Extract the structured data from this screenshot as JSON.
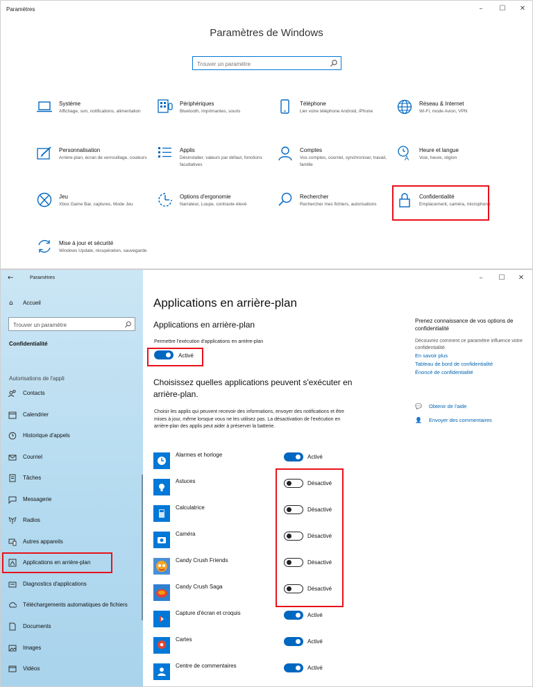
{
  "top_window": {
    "title": "Paramètres",
    "heading": "Paramètres de Windows",
    "search_placeholder": "Trouver un paramètre",
    "categories": [
      {
        "icon": "laptop-icon",
        "title": "Système",
        "desc": "Affichage, son, notifications, alimentation"
      },
      {
        "icon": "keyboard-icon",
        "title": "Périphériques",
        "desc": "Bluetooth, imprimantes, souris"
      },
      {
        "icon": "phone-icon",
        "title": "Téléphone",
        "desc": "Lier votre téléphone Android, iPhone"
      },
      {
        "icon": "globe-icon",
        "title": "Réseau & Internet",
        "desc": "Wi-Fi, mode Avion, VPN"
      },
      {
        "icon": "paint-brush-icon",
        "title": "Personnalisation",
        "desc": "Arrière-plan, écran de verrouillage, couleurs"
      },
      {
        "icon": "apps-list-icon",
        "title": "Applis",
        "desc": "Désinstaller, valeurs par défaut, fonctions facultatives"
      },
      {
        "icon": "person-icon",
        "title": "Comptes",
        "desc": "Vos comptes, courriel, synchroniser, travail, famille"
      },
      {
        "icon": "time-language-icon",
        "title": "Heure et langue",
        "desc": "Voix, heure, région"
      },
      {
        "icon": "xbox-icon",
        "title": "Jeu",
        "desc": "Xbox Game Bar, captures, Mode Jeu"
      },
      {
        "icon": "ease-of-access-icon",
        "title": "Options d'ergonomie",
        "desc": "Narrateur, Loupe, contraste élevé"
      },
      {
        "icon": "search-icon",
        "title": "Rechercher",
        "desc": "Rechercher mes fichiers, autorisations"
      },
      {
        "icon": "lock-icon",
        "title": "Confidentialité",
        "desc": "Emplacement, caméra, microphone"
      },
      {
        "icon": "update-icon",
        "title": "Mise à jour et sécurité",
        "desc": "Windows Update, récupération, sauvegarde"
      }
    ]
  },
  "bottom_window": {
    "title": "Paramètres",
    "sidebar": {
      "home": "Accueil",
      "search_placeholder": "Trouver un paramètre",
      "section": "Confidentialité",
      "group": "Autorisations de l'appli",
      "items": [
        {
          "icon": "contacts-icon",
          "label": "Contacts"
        },
        {
          "icon": "calendar-icon",
          "label": "Calendrier"
        },
        {
          "icon": "call-history-icon",
          "label": "Historique d'appels"
        },
        {
          "icon": "mail-icon",
          "label": "Courriel"
        },
        {
          "icon": "tasks-icon",
          "label": "Tâches"
        },
        {
          "icon": "messaging-icon",
          "label": "Messagerie"
        },
        {
          "icon": "radios-icon",
          "label": "Radios"
        },
        {
          "icon": "other-devices-icon",
          "label": "Autres appareils"
        },
        {
          "icon": "background-apps-icon",
          "label": "Applications en arrière-plan"
        },
        {
          "icon": "diagnostics-icon",
          "label": "Diagnostics d'applications"
        },
        {
          "icon": "downloads-icon",
          "label": "Téléchargements automatiques de fichiers"
        },
        {
          "icon": "documents-icon",
          "label": "Documents"
        },
        {
          "icon": "images-icon",
          "label": "Images"
        },
        {
          "icon": "videos-icon",
          "label": "Vidéos"
        }
      ]
    },
    "main": {
      "title": "Applications en arrière-plan",
      "subtitle": "Applications en arrière-plan",
      "allow_label": "Permettre l'exécution d'applications en arrière-plan",
      "allow_state": "Activé",
      "choose_heading": "Choisissez quelles applications peuvent s'exécuter en arrière-plan.",
      "paragraph": "Choisir les applis qui peuvent recevoir des informations, envoyer des notifications et être mises à jour, même lorsque vous ne les utilisez pas. La désactivation de l'exécution en arrière-plan des applis peut aider à préserver la batterie.",
      "apps": [
        {
          "name": "Alarmes et horloge",
          "state": "Activé",
          "on": true,
          "color": "#0078d7"
        },
        {
          "name": "Astuces",
          "state": "Désactivé",
          "on": false,
          "color": "#0078d7"
        },
        {
          "name": "Calculatrice",
          "state": "Désactivé",
          "on": false,
          "color": "#0078d7"
        },
        {
          "name": "Caméra",
          "state": "Désactivé",
          "on": false,
          "color": "#0078d7"
        },
        {
          "name": "Candy Crush Friends",
          "state": "Désactivé",
          "on": false,
          "color": "#4a8fd8"
        },
        {
          "name": "Candy Crush Saga",
          "state": "Désactivé",
          "on": false,
          "color": "#2f7fd0"
        },
        {
          "name": "Capture d'écran et croquis",
          "state": "Activé",
          "on": true,
          "color": "#0078d7"
        },
        {
          "name": "Cartes",
          "state": "Activé",
          "on": true,
          "color": "#0078d7"
        },
        {
          "name": "Centre de commentaires",
          "state": "Activé",
          "on": true,
          "color": "#0078d7"
        }
      ]
    },
    "side": {
      "question": "Prenez connaissance de vos options de confidentialité",
      "desc": "Découvrez comment ce paramètre influence votre confidentialité.",
      "links": [
        "En savoir plus",
        "Tableau de bord de confidentialité",
        "Énoncé de confidentialité"
      ],
      "help": "Obtenir de l'aide",
      "feedback": "Envoyer des commentaires"
    }
  },
  "colors": {
    "accent": "#0067c0",
    "highlight_border": "#e8101a",
    "sidebar_bg": "#b5dbf0",
    "link": "#0063b1"
  }
}
